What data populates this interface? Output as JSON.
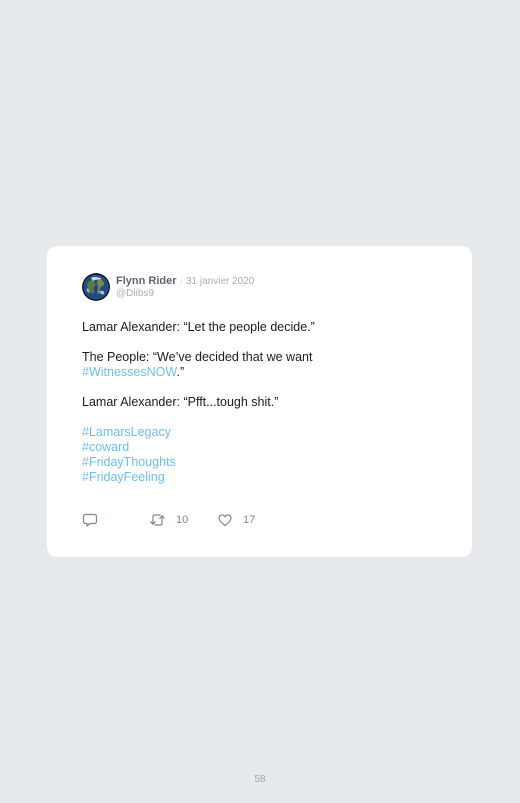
{
  "tweet": {
    "author_name": "Flynn Rider",
    "separator": "·",
    "date": "31 janvier 2020",
    "handle": "@Diibs9",
    "line1": "Lamar Alexander: “Let the people decide.”",
    "line2_prefix": "The People: “We’ve decided that we want",
    "line2_hashtag": "#WitnessesNOW",
    "line2_suffix": ".”",
    "line3": "Lamar Alexander: “Pfft...tough shit.”",
    "hashtags": [
      "#LamarsLegacy",
      "#coward",
      "#FridayThoughts",
      "#FridayFeeling"
    ],
    "retweet_count": "10",
    "like_count": "17"
  },
  "icons": {
    "avatar": "earth-avatar",
    "reply": "reply-icon",
    "retweet": "retweet-icon",
    "like": "heart-icon"
  },
  "colors": {
    "link": "#6cbfee",
    "background": "#e6eaed",
    "card": "#ffffff"
  },
  "page": {
    "number": "58"
  }
}
